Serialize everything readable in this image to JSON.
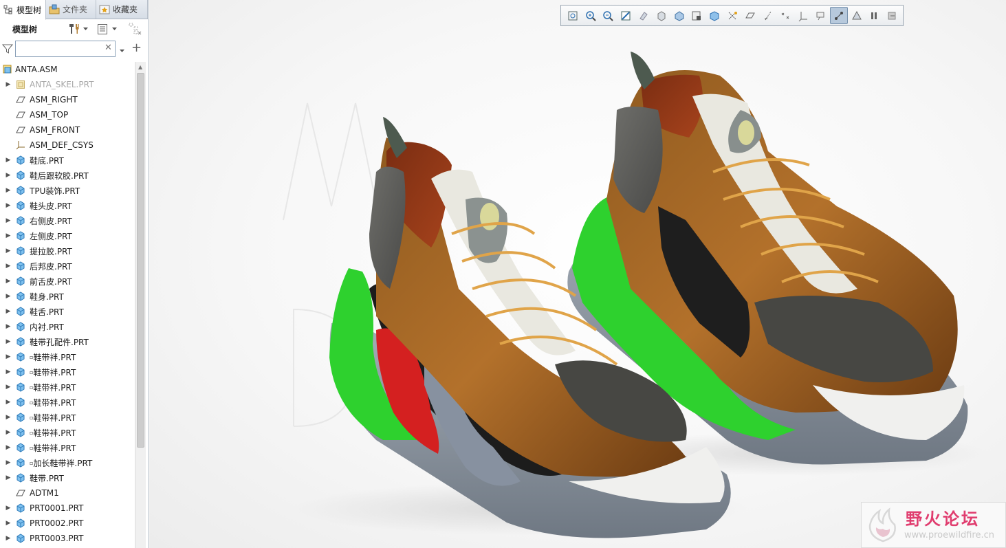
{
  "tabs": [
    {
      "label": "模型树",
      "icon": "tree-icon"
    },
    {
      "label": "文件夹",
      "icon": "folder-browser-icon"
    },
    {
      "label": "收藏夹",
      "icon": "favorites-icon"
    }
  ],
  "model_tree": {
    "title": "模型树",
    "search_value": "",
    "root": "ANTA.ASM",
    "items": [
      {
        "label": "ANTA_SKEL.PRT",
        "icon": "skeleton-icon",
        "expandable": true,
        "dim": true
      },
      {
        "label": "ASM_RIGHT",
        "icon": "datum-plane-icon",
        "expandable": false
      },
      {
        "label": "ASM_TOP",
        "icon": "datum-plane-icon",
        "expandable": false
      },
      {
        "label": "ASM_FRONT",
        "icon": "datum-plane-icon",
        "expandable": false
      },
      {
        "label": "ASM_DEF_CSYS",
        "icon": "csys-icon",
        "expandable": false
      },
      {
        "label": "鞋底.PRT",
        "icon": "part-icon",
        "expandable": true
      },
      {
        "label": "鞋后跟软胶.PRT",
        "icon": "part-icon",
        "expandable": true
      },
      {
        "label": "TPU装饰.PRT",
        "icon": "part-icon",
        "expandable": true
      },
      {
        "label": "鞋头皮.PRT",
        "icon": "part-icon",
        "expandable": true
      },
      {
        "label": "右侧皮.PRT",
        "icon": "part-icon",
        "expandable": true
      },
      {
        "label": "左侧皮.PRT",
        "icon": "part-icon",
        "expandable": true
      },
      {
        "label": "提拉胶.PRT",
        "icon": "part-icon",
        "expandable": true
      },
      {
        "label": "后邦皮.PRT",
        "icon": "part-icon",
        "expandable": true
      },
      {
        "label": "前舌皮.PRT",
        "icon": "part-icon",
        "expandable": true
      },
      {
        "label": "鞋身.PRT",
        "icon": "part-icon",
        "expandable": true
      },
      {
        "label": "鞋舌.PRT",
        "icon": "part-icon",
        "expandable": true
      },
      {
        "label": "内衬.PRT",
        "icon": "part-icon",
        "expandable": true
      },
      {
        "label": "鞋带孔配件.PRT",
        "icon": "part-icon",
        "expandable": true
      },
      {
        "label": "鞋带袢.PRT",
        "icon": "part-icon",
        "expandable": true,
        "marker": true
      },
      {
        "label": "鞋带袢.PRT",
        "icon": "part-icon",
        "expandable": true,
        "marker": true
      },
      {
        "label": "鞋带袢.PRT",
        "icon": "part-icon",
        "expandable": true,
        "marker": true
      },
      {
        "label": "鞋带袢.PRT",
        "icon": "part-icon",
        "expandable": true,
        "marker": true
      },
      {
        "label": "鞋带袢.PRT",
        "icon": "part-icon",
        "expandable": true,
        "marker": true
      },
      {
        "label": "鞋带袢.PRT",
        "icon": "part-icon",
        "expandable": true,
        "marker": true
      },
      {
        "label": "鞋带袢.PRT",
        "icon": "part-icon",
        "expandable": true,
        "marker": true
      },
      {
        "label": "加长鞋带袢.PRT",
        "icon": "part-icon",
        "expandable": true,
        "marker": true
      },
      {
        "label": "鞋带.PRT",
        "icon": "part-icon",
        "expandable": true
      },
      {
        "label": "ADTM1",
        "icon": "datum-plane-icon",
        "expandable": false
      },
      {
        "label": "PRT0001.PRT",
        "icon": "part-icon",
        "expandable": true
      },
      {
        "label": "PRT0002.PRT",
        "icon": "part-icon",
        "expandable": true
      },
      {
        "label": "PRT0003.PRT",
        "icon": "part-icon",
        "expandable": true
      }
    ]
  },
  "view_toolbar": {
    "icons": [
      "refit-icon",
      "zoom-in-icon",
      "zoom-out-icon",
      "repaint-icon",
      "spin-center-icon",
      "display-style-icon",
      "saved-orientations-icon",
      "view-manager-icon",
      "perspective-view-icon",
      "datum-display-icon",
      "plane-display-icon",
      "axis-display-icon",
      "point-display-icon",
      "csys-display-icon",
      "annotation-display-icon",
      "appearance-icon",
      "render-icon",
      "pause-icon",
      "exit-icon"
    ],
    "active_index": 15
  },
  "watermark": {
    "title": "野火论坛",
    "url": "www.proewildfire.cn"
  },
  "colors": {
    "accent": "#e03c6e",
    "panel_border": "#b9c1cb",
    "part_icon": "#5aa9e6",
    "sole_green": "#2ed12e",
    "sole_gray": "#8d97a3"
  }
}
